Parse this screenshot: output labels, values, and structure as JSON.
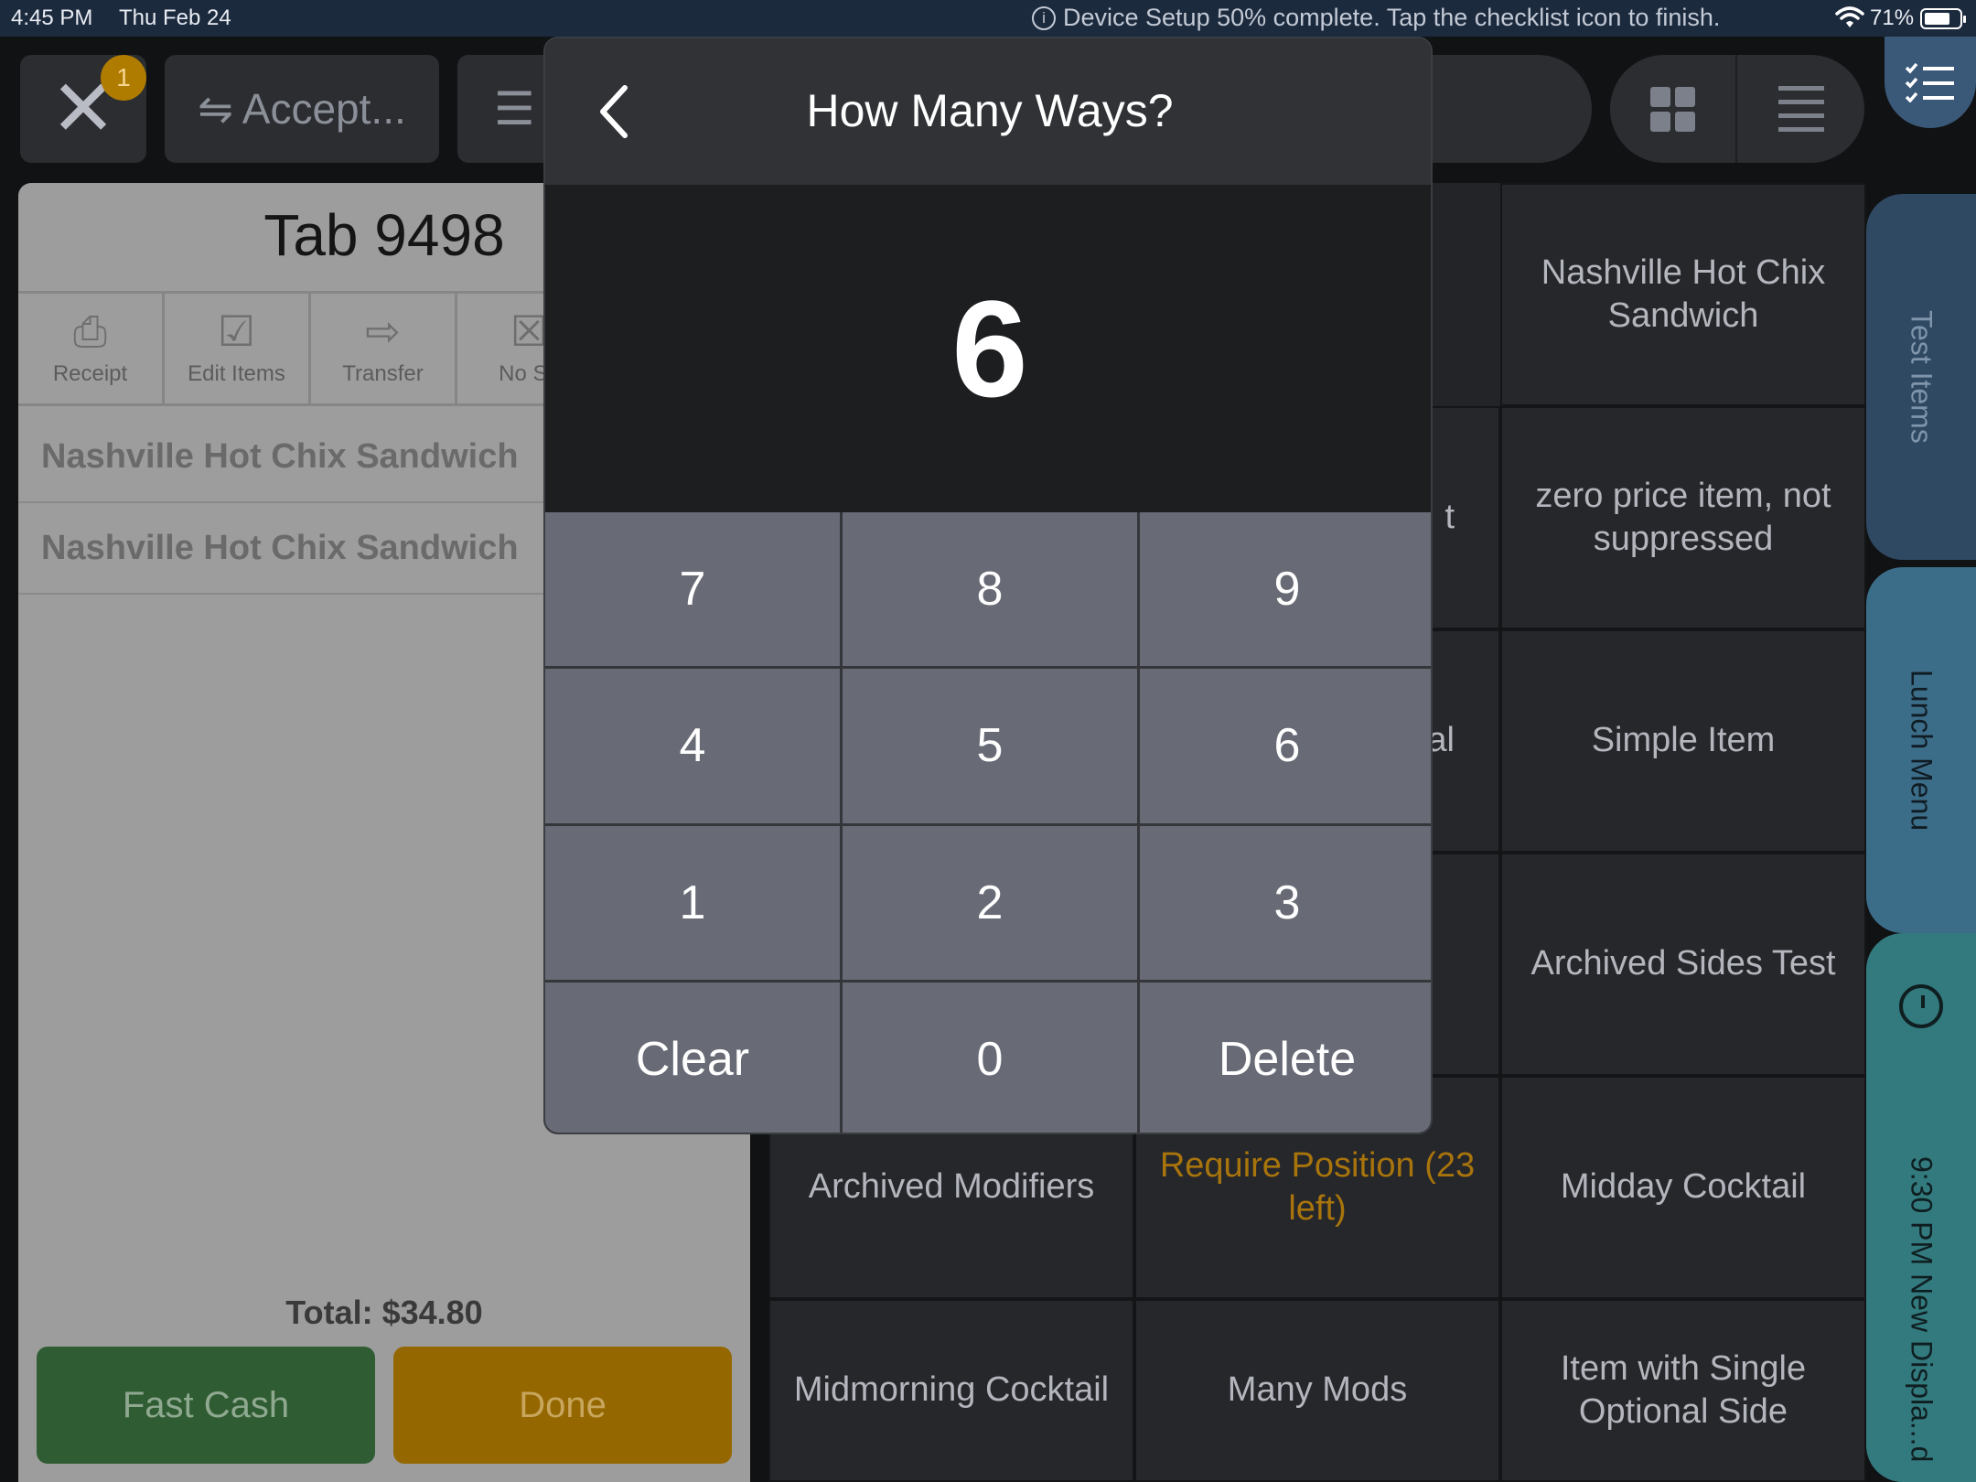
{
  "status_bar": {
    "time": "4:45 PM",
    "date": "Thu Feb 24",
    "setup_message": "Device Setup 50% complete. Tap the checklist icon to finish.",
    "battery": "71%"
  },
  "topbar": {
    "notification_count": "1",
    "accept_label": "Accept..."
  },
  "tab": {
    "title": "Tab 9498",
    "actions": [
      {
        "label": "Receipt",
        "icon": "receipt-icon"
      },
      {
        "label": "Edit Items",
        "icon": "edit-icon"
      },
      {
        "label": "Transfer",
        "icon": "transfer-arrow-icon"
      },
      {
        "label": "No Sa",
        "icon": "no-sale-icon"
      }
    ],
    "items": [
      "Nashville Hot Chix Sandwich",
      "Nashville Hot Chix Sandwich"
    ],
    "total": "Total: $34.80",
    "fast_cash_label": "Fast Cash",
    "done_label": "Done"
  },
  "menu_items": {
    "nashville": "Nashville Hot Chix Sandwich",
    "partial_t": "t",
    "zero_price": "zero price item, not suppressed",
    "partial_al": "al",
    "simple_item": "Simple Item",
    "archived_sides": "Archived Sides Test",
    "archived_modifiers": "Archived Modifiers",
    "require_position": "Require Position (23 left)",
    "midday_cocktail": "Midday Cocktail",
    "midmorning_cocktail": "Midmorning Cocktail",
    "many_mods": "Many Mods",
    "single_optional_side": "Item with Single Optional Side"
  },
  "side_tabs": {
    "test_items": "Test Items",
    "lunch_menu": "Lunch Menu",
    "late_menu": "9:30 PM New Displa...d"
  },
  "modal": {
    "title": "How Many Ways?",
    "value": "6",
    "keys": [
      "7",
      "8",
      "9",
      "4",
      "5",
      "6",
      "1",
      "2",
      "3",
      "Clear",
      "0",
      "Delete"
    ]
  },
  "colors": {
    "fast_cash": "#2f5c33",
    "done": "#946700",
    "warning_text": "#a8740c",
    "keypad_key": "#686b76"
  }
}
